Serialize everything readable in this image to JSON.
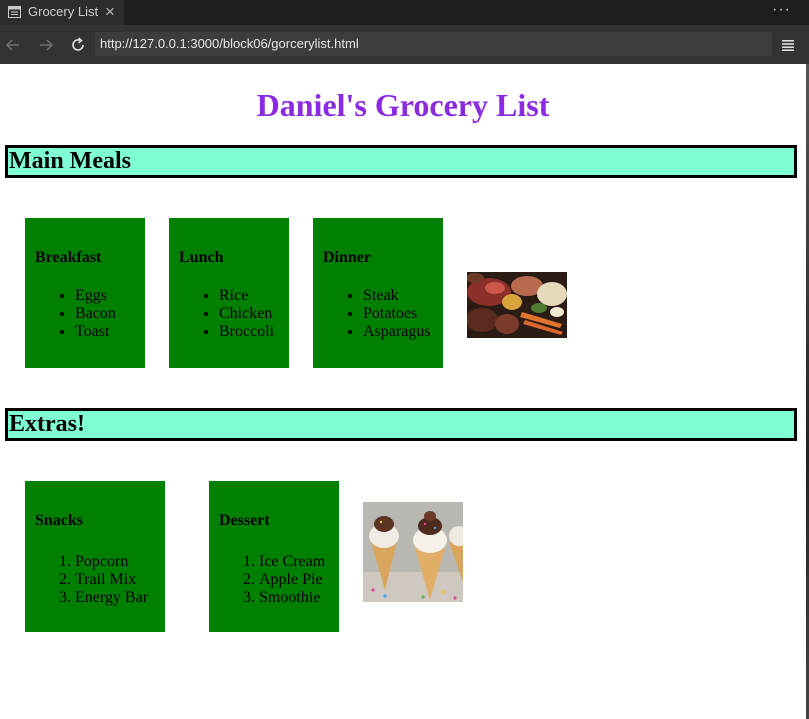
{
  "browser": {
    "tab_title": "Grocery List",
    "tab_close": "×",
    "menu_dots": "···",
    "url": "http://127.0.0.1:3000/block06/gorcerylist.html"
  },
  "page": {
    "title": "Daniel's Grocery List",
    "title_color": "#8a2be2",
    "header_bg": "#7fffd4",
    "box_bg": "#008000",
    "sections": [
      {
        "heading": "Main Meals",
        "boxes": [
          {
            "title": "Breakfast",
            "items": [
              "Eggs",
              "Bacon",
              "Toast"
            ]
          },
          {
            "title": "Lunch",
            "items": [
              "Rice",
              "Chicken",
              "Broccoli"
            ]
          },
          {
            "title": "Dinner",
            "items": [
              "Steak",
              "Potatoes",
              "Asparagus"
            ]
          }
        ],
        "image": "assorted-groceries-photo"
      },
      {
        "heading": "Extras!",
        "boxes": [
          {
            "title": "Snacks",
            "items": [
              "Popcorn",
              "Trail Mix",
              "Energy Bar"
            ]
          },
          {
            "title": "Dessert",
            "items": [
              "Ice Cream",
              "Apple Pie",
              "Smoothie"
            ]
          }
        ],
        "image": "ice-cream-cones-photo"
      }
    ]
  }
}
